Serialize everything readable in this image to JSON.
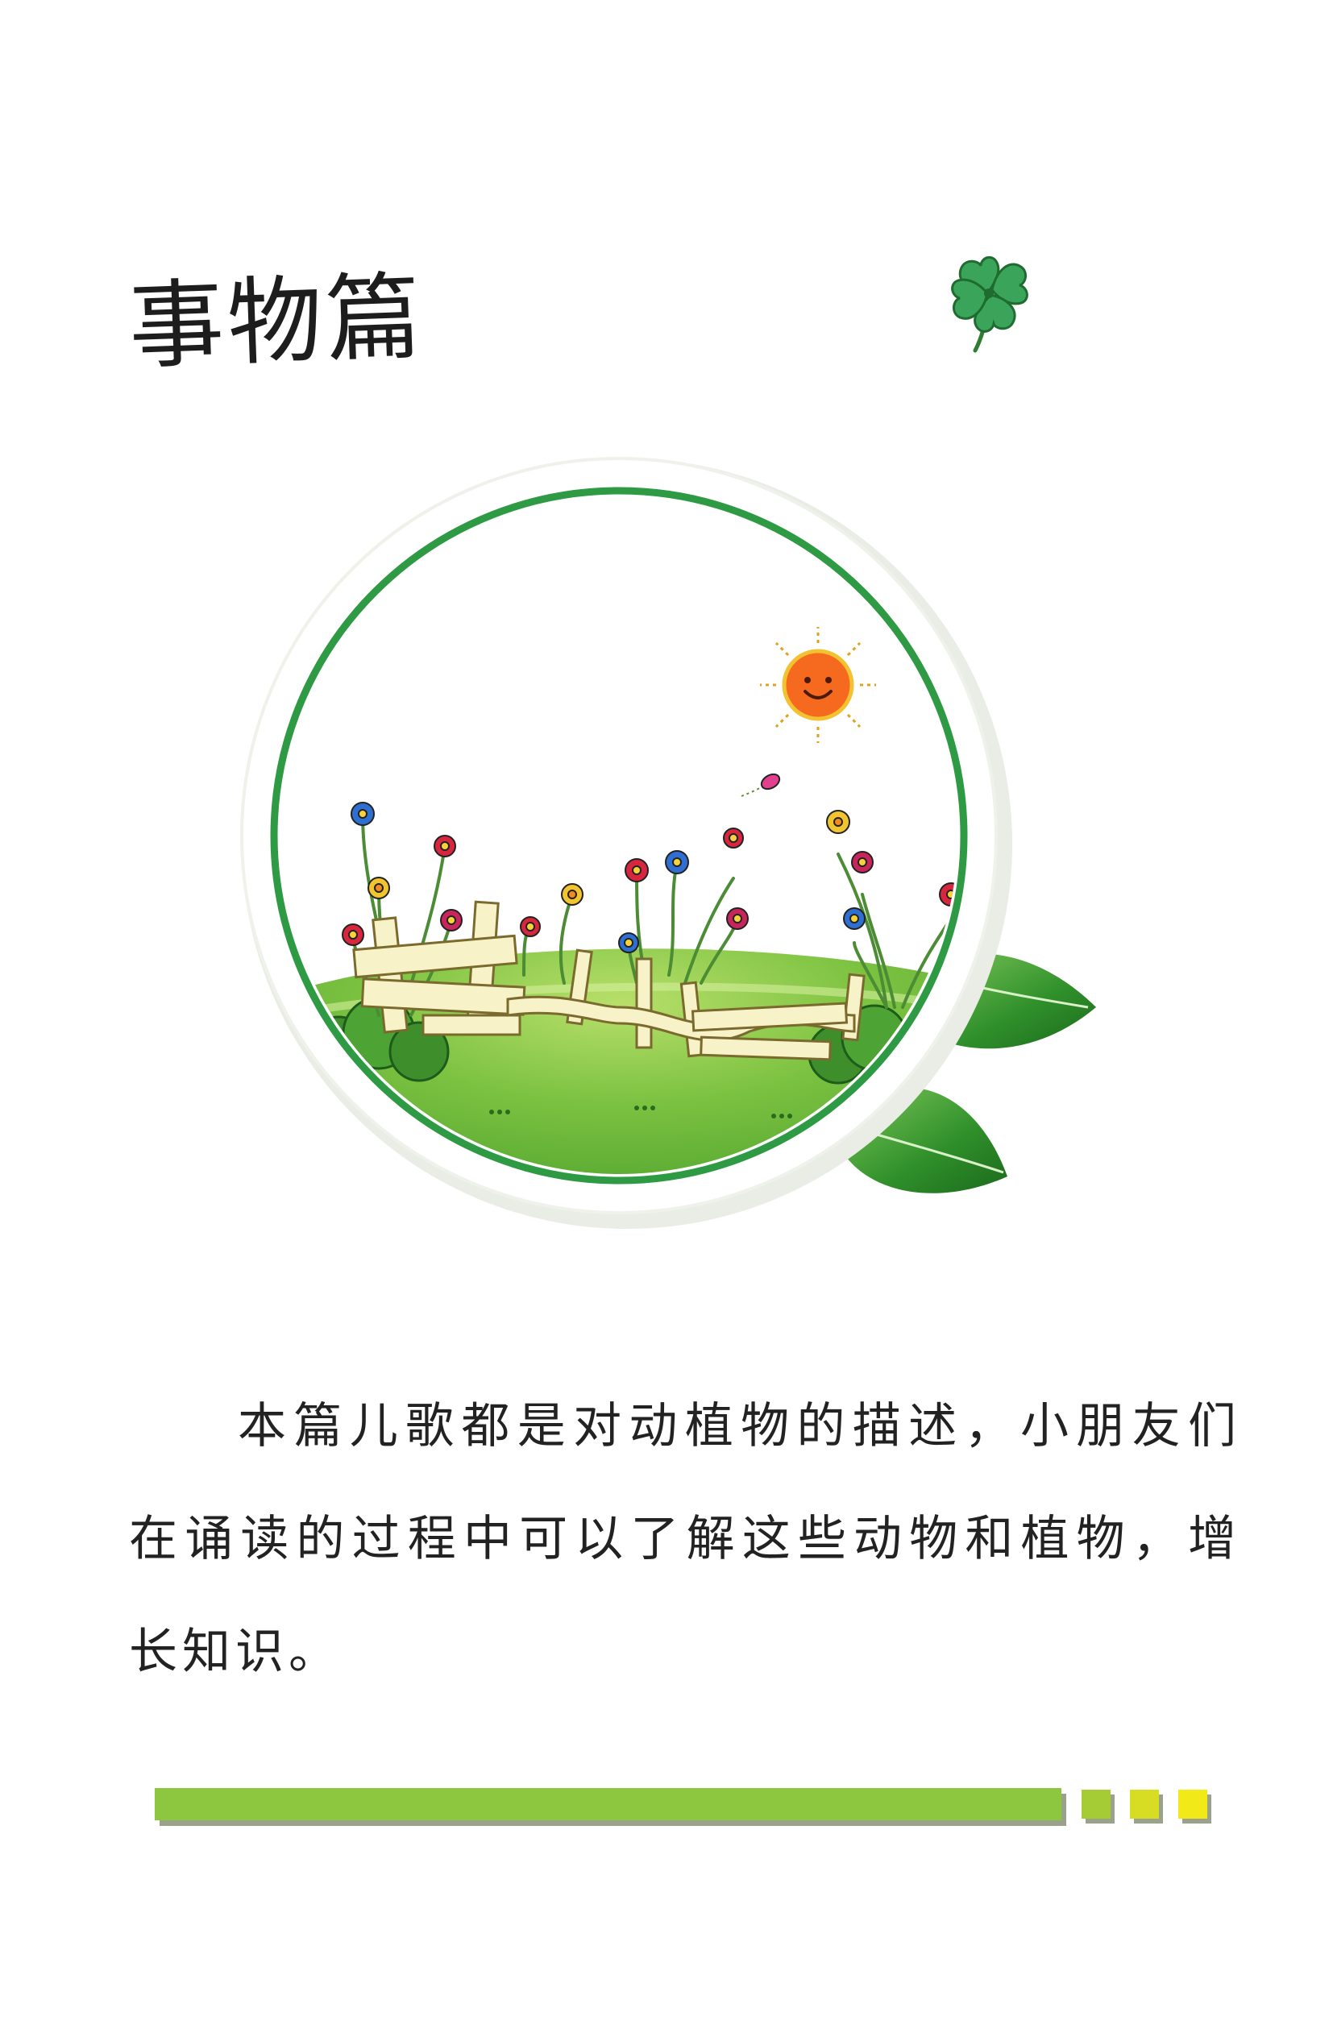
{
  "page": {
    "title": "事物篇",
    "intro": "本篇儿歌都是对动植物的描述，小朋友们在诵读的过程中可以了解这些动物和植物，增长知识。"
  },
  "illustration": {
    "clover_icon": "four-leaf-clover-icon",
    "scene": "garden-fence-flowers-sun-circle",
    "sun_icon": "smiling-sun-icon",
    "leaf_icon": "green-leaf-icon"
  },
  "decoration": {
    "bar_color": "#8dc63f",
    "square_colors": [
      "#a5cc34",
      "#d7dd22",
      "#f2ea18"
    ]
  }
}
